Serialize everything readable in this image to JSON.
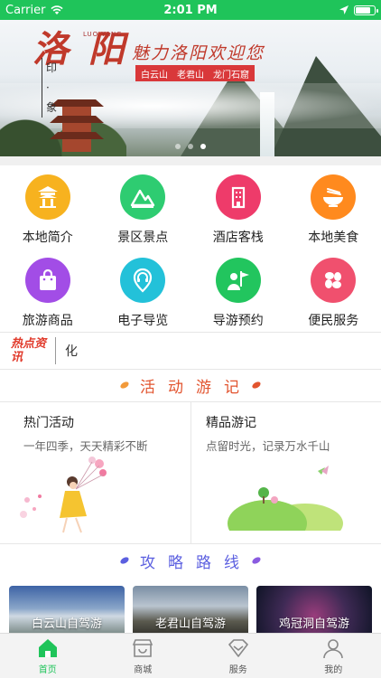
{
  "status_bar": {
    "carrier": "Carrier",
    "time": "2:01 PM",
    "battery_level": 0.85
  },
  "banner": {
    "calligraphy_title": "洛 阳",
    "pinyin": "LUO YANG",
    "yin_xiang": "印·象",
    "slogan": "魅力洛阳欢迎您",
    "tags": [
      "白云山",
      "老君山",
      "龙门石窟"
    ],
    "carousel_total": 3,
    "carousel_active": 3
  },
  "grid": {
    "items": [
      {
        "label": "本地简介",
        "icon": "pavilion-icon",
        "color": "#f7b21f"
      },
      {
        "label": "景区景点",
        "icon": "mountain-icon",
        "color": "#2ecc71"
      },
      {
        "label": "酒店客栈",
        "icon": "hotel-icon",
        "color": "#ee3b6a"
      },
      {
        "label": "本地美食",
        "icon": "food-bowl-icon",
        "color": "#ff8a1e"
      },
      {
        "label": "旅游商品",
        "icon": "shopping-bag-icon",
        "color": "#a24de6"
      },
      {
        "label": "电子导览",
        "icon": "headset-guide-icon",
        "color": "#23c1d9"
      },
      {
        "label": "导游预约",
        "icon": "guide-flag-icon",
        "color": "#22c55e"
      },
      {
        "label": "便民服务",
        "icon": "service-icon",
        "color": "#f0506e"
      }
    ]
  },
  "news": {
    "logo": "热点资讯",
    "text": "化"
  },
  "activity_section": {
    "title_chars": [
      "活",
      "动",
      "游",
      "记"
    ]
  },
  "cards": [
    {
      "title": "热门活动",
      "subtitle": "一年四季，天天精彩不断"
    },
    {
      "title": "精品游记",
      "subtitle": "点留时光，记录万水千山"
    }
  ],
  "route_section": {
    "title_chars": [
      "攻",
      "略",
      "路",
      "线"
    ]
  },
  "routes": [
    {
      "label": "白云山自驾游"
    },
    {
      "label": "老君山自驾游"
    },
    {
      "label": "鸡冠洞自驾游"
    }
  ],
  "tabbar": {
    "items": [
      {
        "label": "首页",
        "icon": "home-icon",
        "active": true
      },
      {
        "label": "商城",
        "icon": "store-icon",
        "active": false
      },
      {
        "label": "服务",
        "icon": "diamond-icon",
        "active": false
      },
      {
        "label": "我的",
        "icon": "person-icon",
        "active": false
      }
    ]
  },
  "colors": {
    "brand_green": "#1fc45a",
    "activity_orange": "#e2542f",
    "route_purple": "#5b5fe0"
  }
}
